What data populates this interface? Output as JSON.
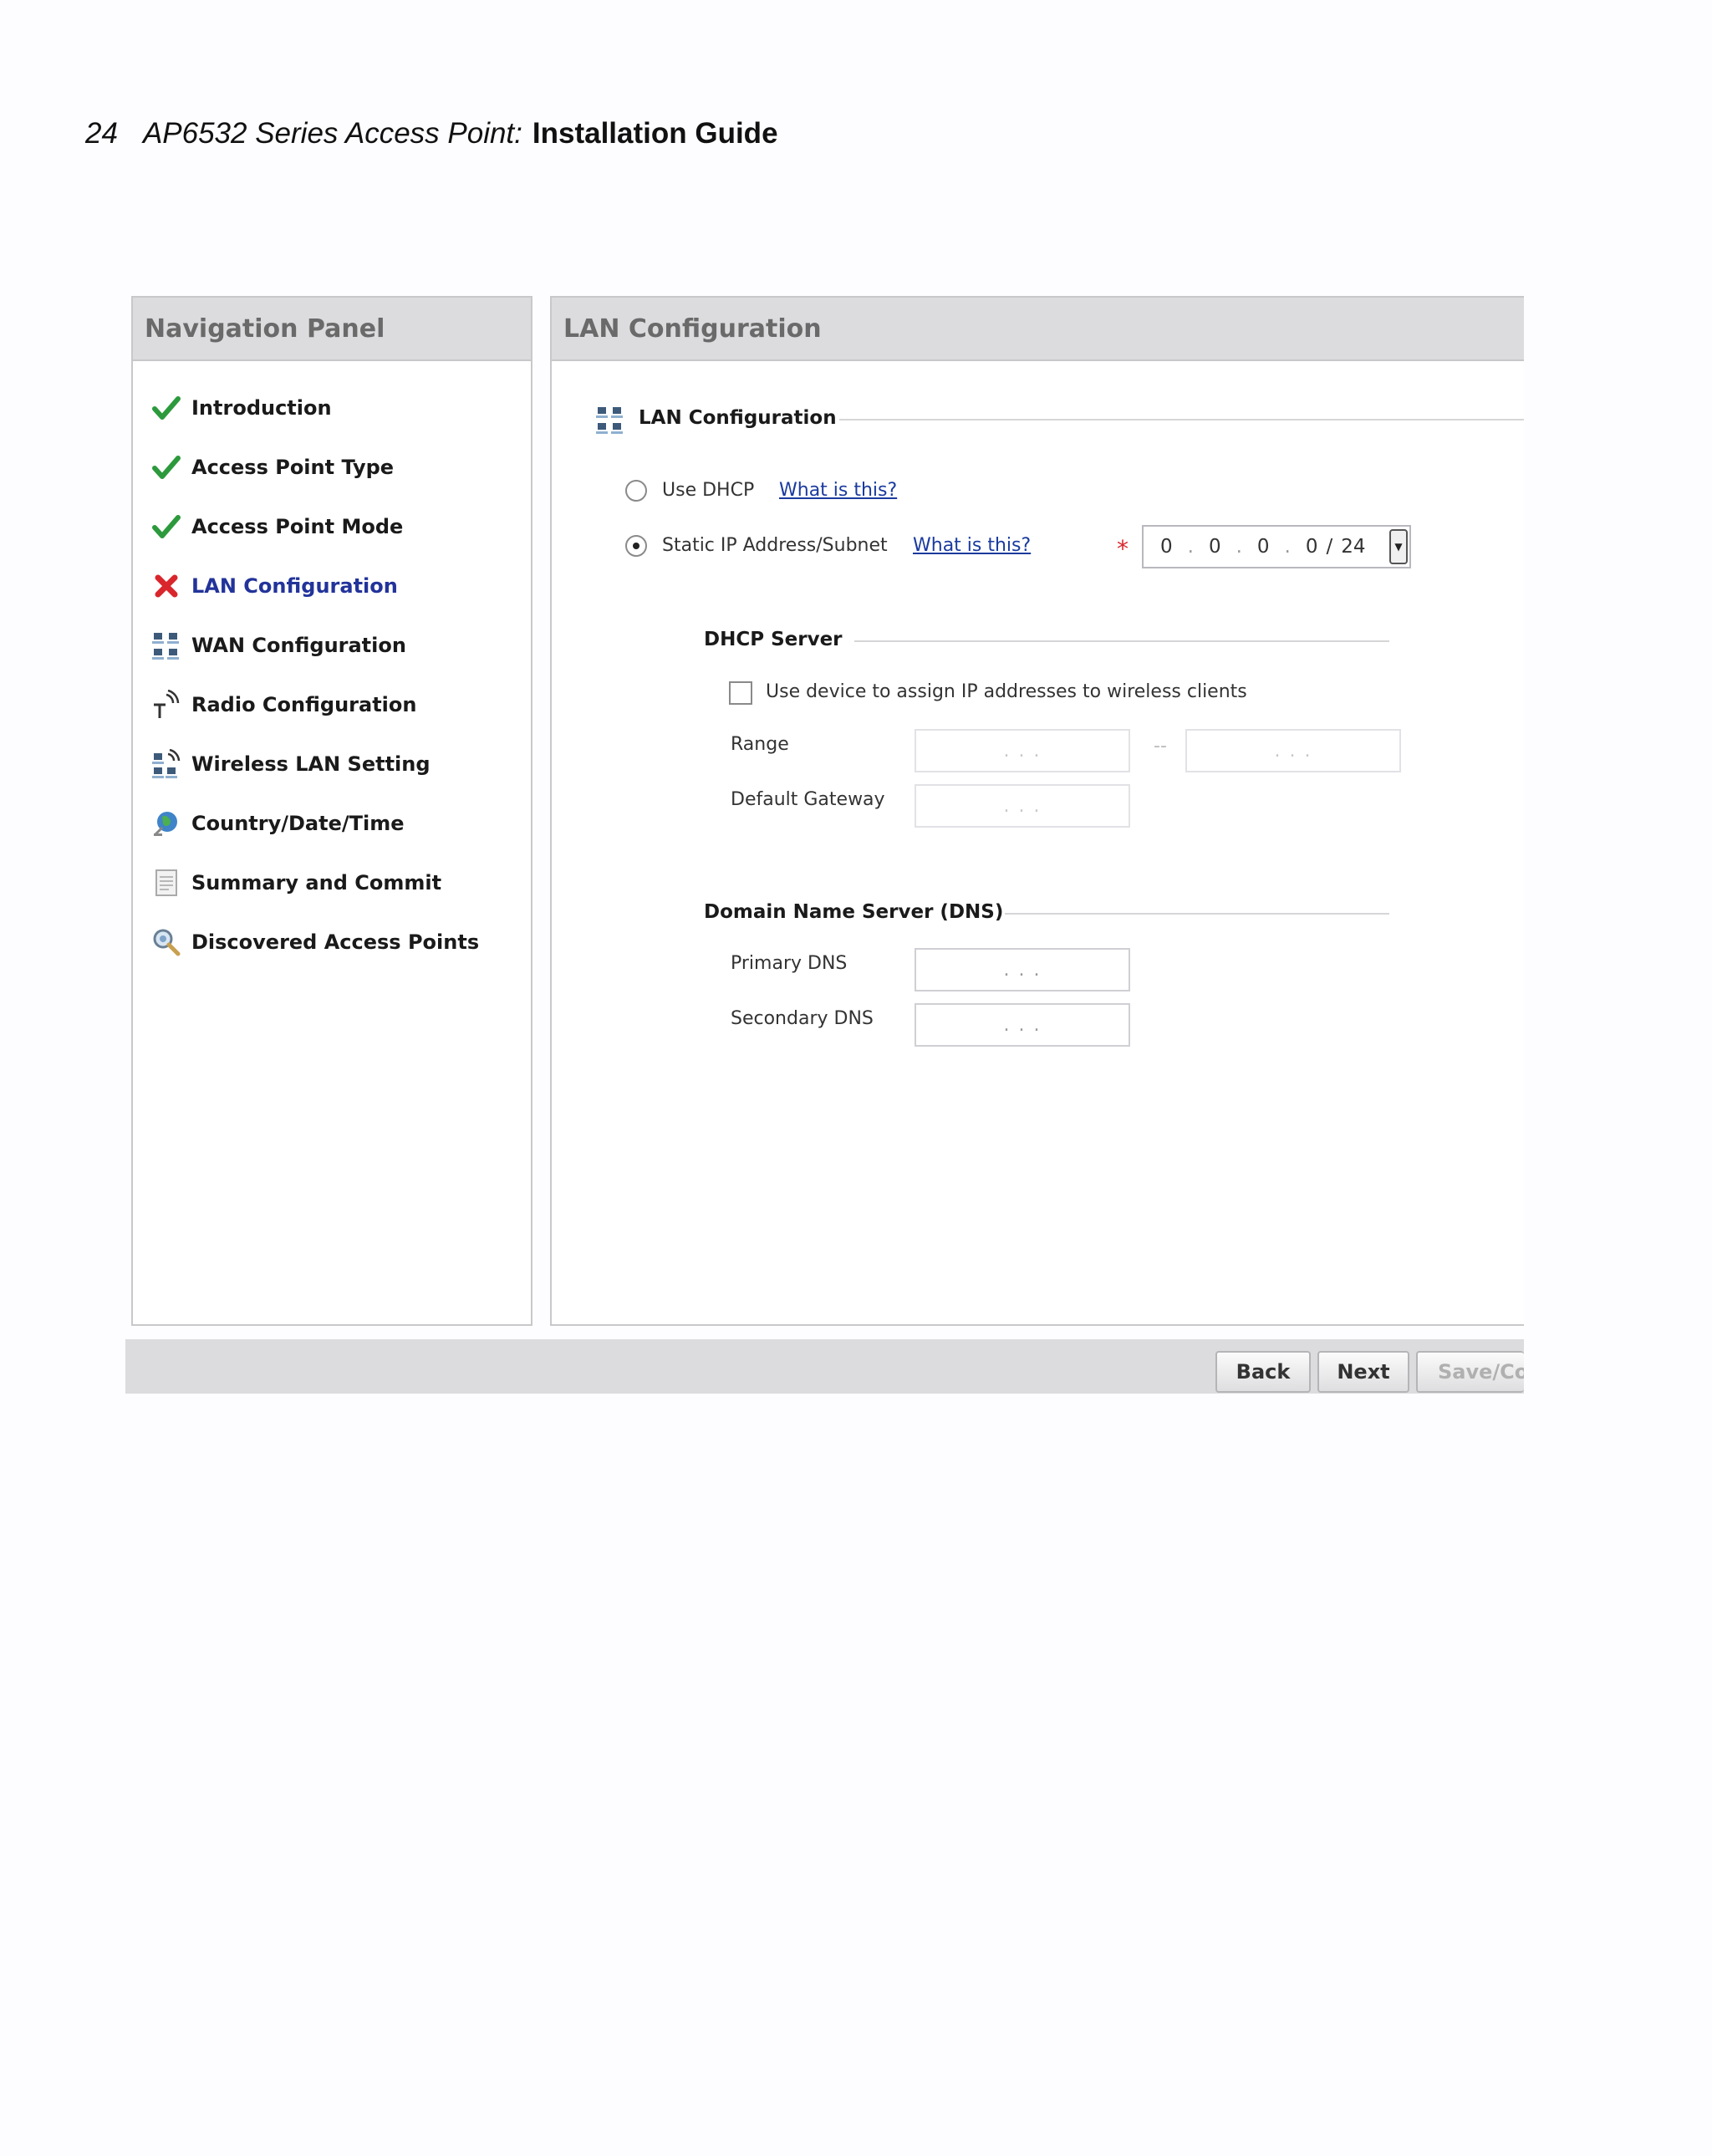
{
  "doc_header": {
    "page_number": "24",
    "series_title": "AP6532 Series Access Point:",
    "guide_title": "Installation Guide"
  },
  "nav_panel": {
    "title": "Navigation Panel",
    "items": [
      {
        "label": "Introduction",
        "icon": "check-icon"
      },
      {
        "label": "Access Point Type",
        "icon": "check-icon"
      },
      {
        "label": "Access Point Mode",
        "icon": "check-icon"
      },
      {
        "label": "LAN Configuration",
        "icon": "error-x-icon"
      },
      {
        "label": "WAN Configuration",
        "icon": "network-icon"
      },
      {
        "label": "Radio Configuration",
        "icon": "antenna-icon"
      },
      {
        "label": "Wireless LAN Setting",
        "icon": "wireless-network-icon"
      },
      {
        "label": "Country/Date/Time",
        "icon": "globe-icon"
      },
      {
        "label": "Summary and Commit",
        "icon": "document-icon"
      },
      {
        "label": "Discovered Access Points",
        "icon": "magnifier-icon"
      }
    ]
  },
  "main": {
    "title": "LAN Configuration",
    "section_title": "LAN Configuration",
    "use_dhcp_label": "Use DHCP",
    "static_ip_label": "Static IP Address/Subnet",
    "what_is_this": "What is this?",
    "required_marker": "*",
    "static_ip": {
      "octets": [
        "0",
        "0",
        "0",
        "0"
      ],
      "separator": "/",
      "mask": "24"
    },
    "dhcp_server": {
      "title": "DHCP Server",
      "checkbox_label": "Use device to assign IP addresses to wireless clients",
      "range_label": "Range",
      "range_separator": "--",
      "gateway_label": "Default Gateway"
    },
    "dns": {
      "title": "Domain Name Server (DNS)",
      "primary_label": "Primary DNS",
      "secondary_label": "Secondary DNS"
    },
    "empty_ip": ".   .   ."
  },
  "footer": {
    "back": "Back",
    "next": "Next",
    "save_commit": "Save/Co"
  },
  "colors": {
    "check": "#2c9a3c",
    "error": "#d9262c",
    "link": "#1a3a9e",
    "panel_header": "#dcdcdf"
  }
}
